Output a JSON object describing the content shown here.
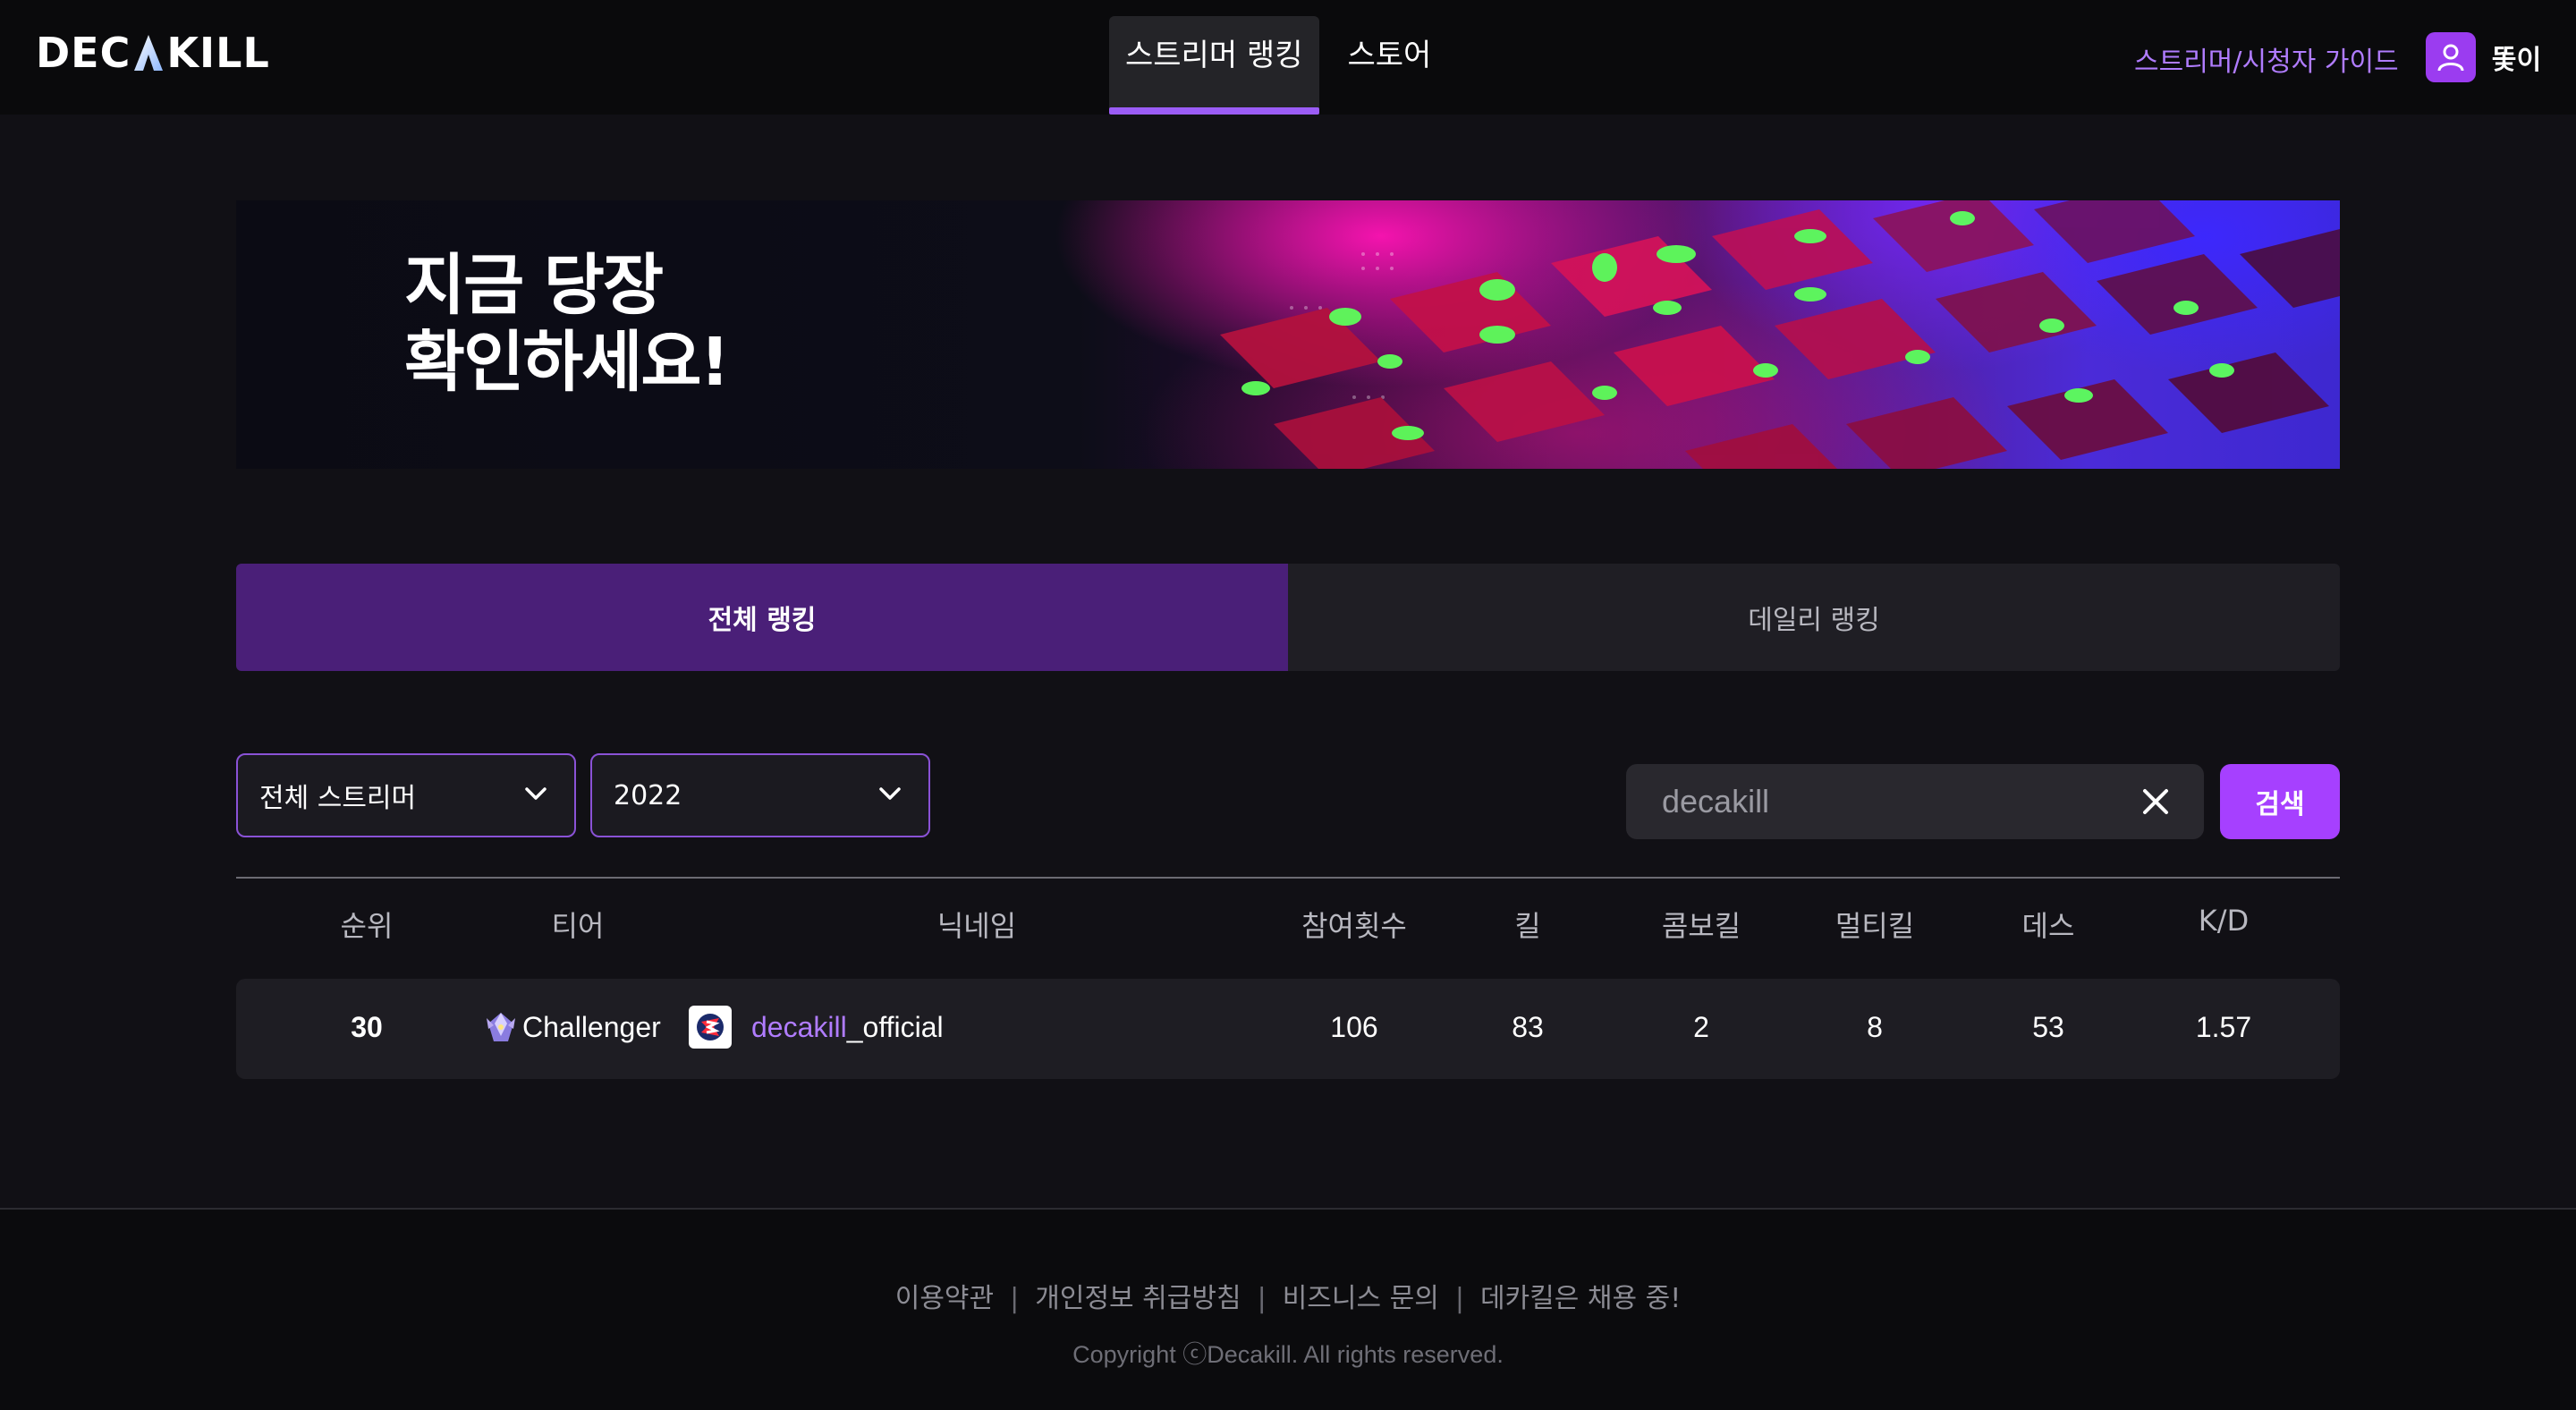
{
  "header": {
    "logo_text": "DECAKILL",
    "nav": [
      {
        "label": "스트리머 랭킹",
        "active": true
      },
      {
        "label": "스토어",
        "active": false
      }
    ],
    "guide_link": "스트리머/시청자 가이드",
    "user_name": "똧이"
  },
  "banner": {
    "line1": "지금 당장",
    "line2": "확인하세요!"
  },
  "ranking_tabs": [
    {
      "label": "전체 랭킹",
      "active": true
    },
    {
      "label": "데일리 랭킹",
      "active": false
    }
  ],
  "filters": {
    "streamer_select": "전체 스트리머",
    "year_select": "2022",
    "search_value": "decakill",
    "search_button": "검색"
  },
  "table": {
    "headers": {
      "rank": "순위",
      "tier": "티어",
      "nickname": "닉네임",
      "participations": "참여횟수",
      "kills": "킬",
      "combo_kills": "콤보킬",
      "multi_kills": "멀티킬",
      "deaths": "데스",
      "kd": "K/D"
    },
    "rows": [
      {
        "rank": "30",
        "tier": "Challenger",
        "nickname_highlight": "decakill",
        "nickname_rest": "_official",
        "participations": "106",
        "kills": "83",
        "combo_kills": "2",
        "multi_kills": "8",
        "deaths": "53",
        "kd": "1.57"
      }
    ]
  },
  "footer": {
    "links": [
      "이용약관",
      "개인정보 취급방침",
      "비즈니스 문의",
      "데카킬은 채용 중!"
    ],
    "copyright": "Copyright ⓒDecakill. All rights reserved."
  },
  "colors": {
    "accent": "#a640ff",
    "tab_active": "#4a1f78",
    "highlight_text": "#b07cff",
    "background": "#111015"
  }
}
